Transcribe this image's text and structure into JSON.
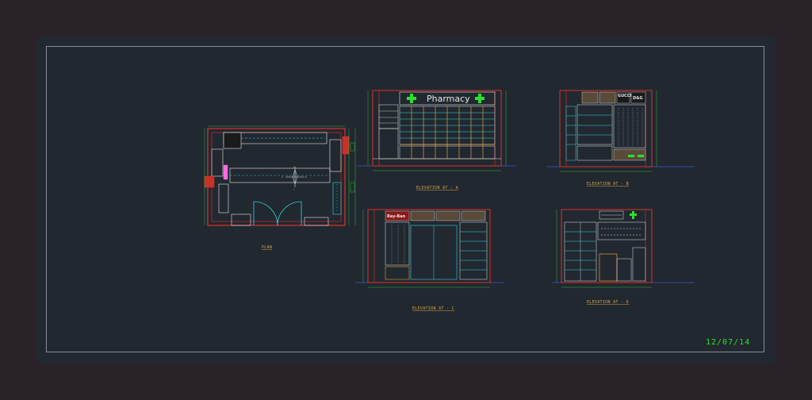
{
  "sheet": {
    "date": "12/07/14",
    "sign_text": "Pharmacy",
    "brand_1": "GUCCI",
    "brand_2": "D&G",
    "brand_3": "Ray-Ban"
  },
  "views": {
    "plan": "PLAN",
    "elev_a": "ELEVATION AT - A",
    "elev_b": "ELEVATION AT - B",
    "elev_c": "ELEVATION AT - C",
    "elev_d": "ELEVATION AT - D"
  },
  "compass": {
    "n": "A",
    "e": "B",
    "s": "C",
    "w": "D"
  },
  "colors": {
    "background": "#2a2229",
    "sheet": "#212830",
    "frame": "#8a8f96",
    "wall": "#e0302a",
    "shelf": "#35d8e0",
    "furniture": "#e8e8e8",
    "dimension": "#2ee02e",
    "label": "#d8a24a",
    "accent": "#ff6adf",
    "floor_line": "#3a5ad8"
  }
}
